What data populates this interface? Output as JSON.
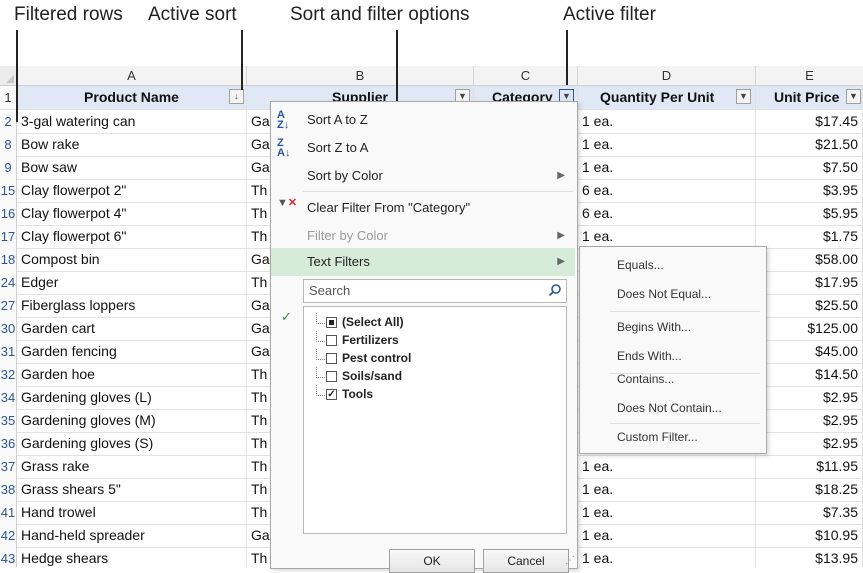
{
  "callouts": {
    "filtered_rows": "Filtered rows",
    "active_sort": "Active sort",
    "sort_filter": "Sort and filter options",
    "active_filter": "Active filter"
  },
  "columns": [
    "A",
    "B",
    "C",
    "D",
    "E"
  ],
  "header_row": {
    "num": "1",
    "product": "Product Name",
    "supplier": "Supplier",
    "category": "Category",
    "quantity": "Quantity Per Unit",
    "price": "Unit Price"
  },
  "rows": [
    {
      "num": "2",
      "product": "3-gal watering can",
      "supplier": "Ga",
      "qty": "1 ea.",
      "price": "$17.45"
    },
    {
      "num": "8",
      "product": "Bow rake",
      "supplier": "Ga",
      "qty": "1 ea.",
      "price": "$21.50"
    },
    {
      "num": "9",
      "product": "Bow saw",
      "supplier": "Ga",
      "qty": "1 ea.",
      "price": "$7.50"
    },
    {
      "num": "15",
      "product": "Clay flowerpot 2\"",
      "supplier": "Th",
      "qty": "6 ea.",
      "price": "$3.95"
    },
    {
      "num": "16",
      "product": "Clay flowerpot 4\"",
      "supplier": "Th",
      "qty": "6 ea.",
      "price": "$5.95"
    },
    {
      "num": "17",
      "product": "Clay flowerpot 6\"",
      "supplier": "Th",
      "qty": "1 ea.",
      "price": "$1.75"
    },
    {
      "num": "18",
      "product": "Compost bin",
      "supplier": "Ga",
      "qty": "",
      "price": "$58.00"
    },
    {
      "num": "24",
      "product": "Edger",
      "supplier": "Th",
      "qty": "",
      "price": "$17.95"
    },
    {
      "num": "27",
      "product": "Fiberglass loppers",
      "supplier": "Ga",
      "qty": "",
      "price": "$25.50"
    },
    {
      "num": "30",
      "product": "Garden cart",
      "supplier": "Ga",
      "qty": "",
      "price": "$125.00"
    },
    {
      "num": "31",
      "product": "Garden fencing",
      "supplier": "Ga",
      "qty": "",
      "price": "$45.00"
    },
    {
      "num": "32",
      "product": "Garden hoe",
      "supplier": "Th",
      "qty": "",
      "price": "$14.50"
    },
    {
      "num": "34",
      "product": "Gardening gloves (L)",
      "supplier": "Th",
      "qty": "",
      "price": "$2.95"
    },
    {
      "num": "35",
      "product": "Gardening gloves (M)",
      "supplier": "Th",
      "qty": "",
      "price": "$2.95"
    },
    {
      "num": "36",
      "product": "Gardening gloves (S)",
      "supplier": "Th",
      "qty": "",
      "price": "$2.95"
    },
    {
      "num": "37",
      "product": "Grass rake",
      "supplier": "Th",
      "qty": "1 ea.",
      "price": "$11.95"
    },
    {
      "num": "38",
      "product": "Grass shears 5\"",
      "supplier": "Th",
      "qty": "1 ea.",
      "price": "$18.25"
    },
    {
      "num": "41",
      "product": "Hand trowel",
      "supplier": "Th",
      "qty": "1 ea.",
      "price": "$7.35"
    },
    {
      "num": "42",
      "product": "Hand-held spreader",
      "supplier": "Ga",
      "qty": "1 ea.",
      "price": "$10.95"
    },
    {
      "num": "43",
      "product": "Hedge shears",
      "supplier": "Th",
      "qty": "1 ea.",
      "price": "$13.95"
    }
  ],
  "menu": {
    "sort_az": "Sort A to Z",
    "sort_za": "Sort Z to A",
    "sort_color": "Sort by Color",
    "clear_filter": "Clear Filter From \"Category\"",
    "filter_color": "Filter by Color",
    "text_filters": "Text Filters",
    "search_placeholder": "Search",
    "items": [
      {
        "label": "(Select All)",
        "state": "partial"
      },
      {
        "label": "Fertilizers",
        "state": "unchecked"
      },
      {
        "label": "Pest control",
        "state": "unchecked"
      },
      {
        "label": "Soils/sand",
        "state": "unchecked"
      },
      {
        "label": "Tools",
        "state": "checked"
      }
    ],
    "ok": "OK",
    "cancel": "Cancel"
  },
  "submenu": {
    "equals": "Equals...",
    "not_equal": "Does Not Equal...",
    "begins_with": "Begins With...",
    "ends_with": "Ends With...",
    "contains": "Contains...",
    "not_contain": "Does Not Contain...",
    "custom": "Custom Filter..."
  },
  "colors": {
    "highlight": "#d6ebd8",
    "header_fill": "#dfe8f4",
    "row_number": "#2b579a"
  }
}
